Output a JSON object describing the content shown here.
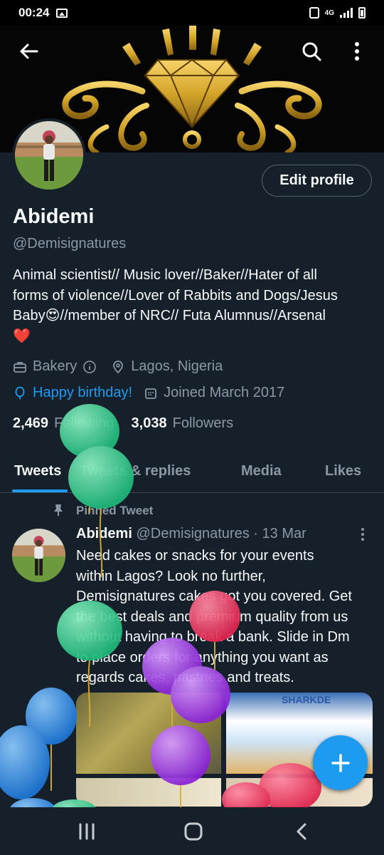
{
  "status_bar": {
    "time": "00:24",
    "network": "4G"
  },
  "profile": {
    "name": "Abidemi",
    "handle": "@Demisignatures",
    "edit_label": "Edit profile",
    "bio_lines": [
      "Animal scientist// Music lover//Baker//Hater of all",
      "forms of violence//Lover of Rabbits and Dogs/Jesus",
      "Baby😍//member of NRC// Futa Alumnus//Arsenal",
      "❤️"
    ],
    "category": "Bakery",
    "location": "Lagos, Nigeria",
    "birthday": "Happy birthday!",
    "joined": "Joined March 2017",
    "following_count": "2,469",
    "following_label": "Following",
    "followers_count": "3,038",
    "followers_label": "Followers"
  },
  "tabs": [
    {
      "label": "Tweets",
      "active": true
    },
    {
      "label": "Tweets & replies",
      "active": false
    },
    {
      "label": "Media",
      "active": false
    },
    {
      "label": "Likes",
      "active": false
    }
  ],
  "tweet": {
    "pinned_label": "Pinned Tweet",
    "author": "Abidemi",
    "handle": "@Demisignatures",
    "separator": "·",
    "date": "13 Mar",
    "text_lines": [
      "Need cakes or snacks for your events",
      "within Lagos? Look no further,",
      "Demisignatures cakes got you covered. Get",
      "the best deals and premium quality from us",
      "without having to break a bank. Slide in Dm",
      "to place orders for anything you want as",
      "regards cakes, pastries and treats."
    ],
    "media_caption": "SHARKDE"
  },
  "colors": {
    "background": "#15202b",
    "accent": "#1d9bf0",
    "muted": "#8b98a5",
    "text": "#f7f9f9",
    "banner_gold": "#d4a52a"
  },
  "icons": {
    "back": "arrow-left-icon",
    "search": "search-icon",
    "more": "more-vertical-icon",
    "compose": "plus-icon"
  }
}
